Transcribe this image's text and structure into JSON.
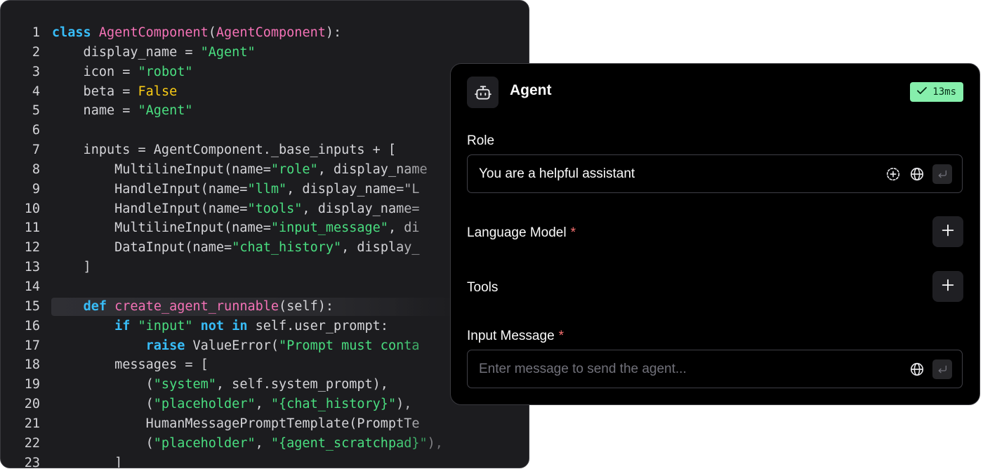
{
  "code": {
    "lines": [
      {
        "n": "1",
        "tokens": [
          {
            "c": "kw",
            "t": "class"
          },
          {
            "c": "txt",
            "t": " "
          },
          {
            "c": "cls",
            "t": "AgentComponent"
          },
          {
            "c": "txt",
            "t": "("
          },
          {
            "c": "cls",
            "t": "AgentComponent"
          },
          {
            "c": "txt",
            "t": "):"
          }
        ]
      },
      {
        "n": "2",
        "tokens": [
          {
            "c": "txt",
            "t": "    display_name = "
          },
          {
            "c": "str",
            "t": "\"Agent\""
          }
        ]
      },
      {
        "n": "3",
        "tokens": [
          {
            "c": "txt",
            "t": "    icon = "
          },
          {
            "c": "str",
            "t": "\"robot\""
          }
        ]
      },
      {
        "n": "4",
        "tokens": [
          {
            "c": "txt",
            "t": "    beta = "
          },
          {
            "c": "const",
            "t": "False"
          }
        ]
      },
      {
        "n": "5",
        "tokens": [
          {
            "c": "txt",
            "t": "    name = "
          },
          {
            "c": "str",
            "t": "\"Agent\""
          }
        ]
      },
      {
        "n": "6",
        "tokens": []
      },
      {
        "n": "7",
        "tokens": [
          {
            "c": "txt",
            "t": "    inputs = AgentComponent._base_inputs + ["
          }
        ]
      },
      {
        "n": "8",
        "tokens": [
          {
            "c": "txt",
            "t": "        MultilineInput(name="
          },
          {
            "c": "str",
            "t": "\"role\""
          },
          {
            "c": "txt",
            "t": ", display_name"
          }
        ]
      },
      {
        "n": "9",
        "tokens": [
          {
            "c": "txt",
            "t": "        HandleInput(name="
          },
          {
            "c": "str",
            "t": "\"llm\""
          },
          {
            "c": "txt",
            "t": ", display_name=\"L"
          }
        ]
      },
      {
        "n": "10",
        "tokens": [
          {
            "c": "txt",
            "t": "        HandleInput(name="
          },
          {
            "c": "str",
            "t": "\"tools\""
          },
          {
            "c": "txt",
            "t": ", display_name="
          }
        ]
      },
      {
        "n": "11",
        "tokens": [
          {
            "c": "txt",
            "t": "        MultilineInput(name="
          },
          {
            "c": "str",
            "t": "\"input_message\""
          },
          {
            "c": "txt",
            "t": ", di"
          }
        ]
      },
      {
        "n": "12",
        "tokens": [
          {
            "c": "txt",
            "t": "        DataInput(name="
          },
          {
            "c": "str",
            "t": "\"chat_history\""
          },
          {
            "c": "txt",
            "t": ", display_"
          }
        ]
      },
      {
        "n": "13",
        "tokens": [
          {
            "c": "txt",
            "t": "    ]"
          }
        ]
      },
      {
        "n": "14",
        "tokens": []
      },
      {
        "n": "15",
        "highlight": true,
        "tokens": [
          {
            "c": "txt",
            "t": "    "
          },
          {
            "c": "kw",
            "t": "def"
          },
          {
            "c": "txt",
            "t": " "
          },
          {
            "c": "cls",
            "t": "create_agent_runnable"
          },
          {
            "c": "txt",
            "t": "(self):"
          }
        ]
      },
      {
        "n": "16",
        "tokens": [
          {
            "c": "txt",
            "t": "        "
          },
          {
            "c": "kw",
            "t": "if"
          },
          {
            "c": "txt",
            "t": " "
          },
          {
            "c": "str",
            "t": "\"input\""
          },
          {
            "c": "txt",
            "t": " "
          },
          {
            "c": "kw",
            "t": "not in"
          },
          {
            "c": "txt",
            "t": " self.user_prompt:"
          }
        ]
      },
      {
        "n": "17",
        "tokens": [
          {
            "c": "txt",
            "t": "            "
          },
          {
            "c": "kw",
            "t": "raise"
          },
          {
            "c": "txt",
            "t": " ValueError("
          },
          {
            "c": "str",
            "t": "\"Prompt must conta"
          }
        ]
      },
      {
        "n": "18",
        "tokens": [
          {
            "c": "txt",
            "t": "        messages = ["
          }
        ]
      },
      {
        "n": "19",
        "tokens": [
          {
            "c": "txt",
            "t": "            ("
          },
          {
            "c": "str",
            "t": "\"system\""
          },
          {
            "c": "txt",
            "t": ", self.system_prompt),"
          }
        ]
      },
      {
        "n": "20",
        "tokens": [
          {
            "c": "txt",
            "t": "            ("
          },
          {
            "c": "str",
            "t": "\"placeholder\""
          },
          {
            "c": "txt",
            "t": ", "
          },
          {
            "c": "str",
            "t": "\"{chat_history}\""
          },
          {
            "c": "txt",
            "t": "),"
          }
        ]
      },
      {
        "n": "21",
        "tokens": [
          {
            "c": "txt",
            "t": "            HumanMessagePromptTemplate(PromptTe"
          }
        ]
      },
      {
        "n": "22",
        "tokens": [
          {
            "c": "txt",
            "t": "            ("
          },
          {
            "c": "str",
            "t": "\"placeholder\""
          },
          {
            "c": "txt",
            "t": ", "
          },
          {
            "c": "str",
            "t": "\"{agent_scratchpad}\""
          },
          {
            "c": "txt",
            "t": "),"
          }
        ]
      },
      {
        "n": "23",
        "tokens": [
          {
            "c": "txt",
            "t": "        ]"
          }
        ]
      }
    ]
  },
  "agent": {
    "title": "Agent",
    "icon": "robot-icon",
    "badge": {
      "text": "13ms",
      "color": "#86efac"
    },
    "role": {
      "label": "Role",
      "value": "You are a helpful assistant"
    },
    "language_model": {
      "label": "Language Model",
      "required_mark": "*"
    },
    "tools": {
      "label": "Tools"
    },
    "input_message": {
      "label": "Input Message",
      "required_mark": "*",
      "placeholder": "Enter message to send the agent..."
    }
  }
}
